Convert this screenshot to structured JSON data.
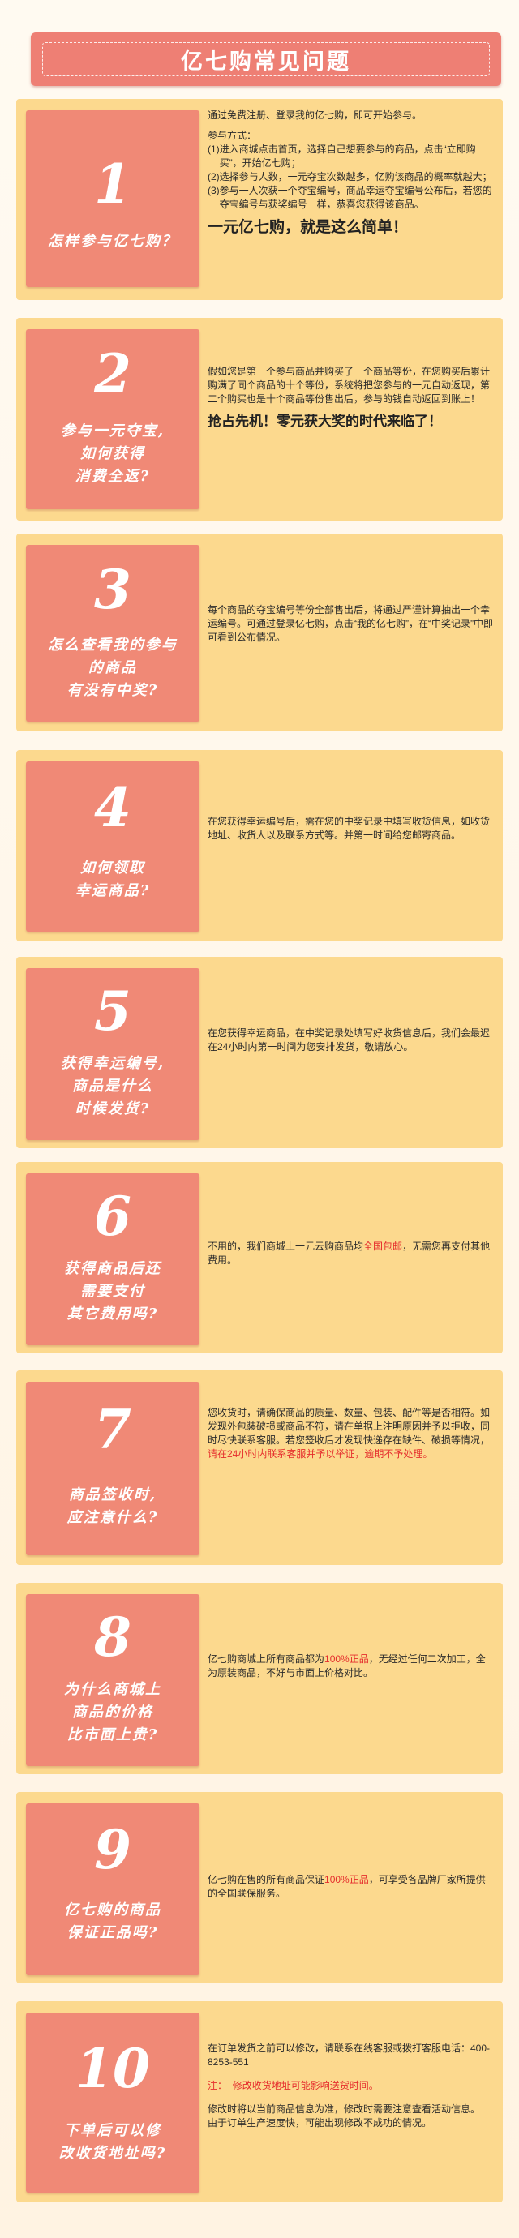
{
  "page_title": "亿七购常见问题",
  "faqs": [
    {
      "number": "1",
      "question": [
        "怎样参与亿七购？"
      ],
      "intro": "通过免费注册、登录我的亿七购，即可开始参与。",
      "methods_title": "参与方式：",
      "steps": [
        {
          "n": "(1)",
          "t": "进入商城点击首页，选择自己想要参与的商品，点击“立即购买”，开始亿七购；"
        },
        {
          "n": "(2)",
          "t": "选择参与人数，一元夺宝次数越多，亿购该商品的概率就越大；"
        },
        {
          "n": "(3)",
          "t": "参与一人次获一个夺宝编号，商品幸运夺宝编号公布后，若您的夺宝编号与获奖编号一样，恭喜您获得该商品。"
        }
      ],
      "highlight": "一元亿七购，就是这么简单！"
    },
    {
      "number": "2",
      "question": [
        "参与一元夺宝,",
        "如何获得",
        "消费全返?"
      ],
      "body": "假如您是第一个参与商品并购买了一个商品等份，在您购买后累计购满了同个商品的十个等份，系统将把您参与的一元自动返现，第二个购买也是十个商品等份售出后，参与的钱自动返回到账上！",
      "highlight": "抢占先机！零元获大奖的时代来临了！"
    },
    {
      "number": "3",
      "question": [
        "怎么查看我的参与",
        "的商品",
        "有没有中奖?"
      ],
      "body": "每个商品的夺宝编号等份全部售出后，将通过严谨计算抽出一个幸运编号。可通过登录亿七购，点击“我的亿七购”，在“中奖记录”中即可看到公布情况。"
    },
    {
      "number": "4",
      "question": [
        "如何领取",
        "幸运商品?"
      ],
      "body": "在您获得幸运编号后，需在您的中奖记录中填写收货信息，如收货地址、收货人以及联系方式等。并第一时间给您邮寄商品。"
    },
    {
      "number": "5",
      "question": [
        "获得幸运编号,",
        "商品是什么",
        "时候发货?"
      ],
      "body": "在您获得幸运商品，在中奖记录处填写好收货信息后，我们会最迟在24小时内第一时间为您安排发货，敬请放心。"
    },
    {
      "number": "6",
      "question": [
        "获得商品后还",
        "需要支付",
        "其它费用吗?"
      ],
      "body_pre": "不用的，我们商城上一元云购商品均",
      "body_red": "全国包邮",
      "body_post": "，无需您再支付其他费用。"
    },
    {
      "number": "7",
      "question": [
        "商品签收时,",
        "应注意什么?"
      ],
      "body": "您收货时，请确保商品的质量、数量、包装、配件等是否相符。如发现外包装破损或商品不符，请在单据上注明原因并予以拒收，同时尽快联系客服。若您签收后才发现快递存在缺件、破损等情况，",
      "body_red": "请在24小时内联系客服并予以举证，逾期不予处理。"
    },
    {
      "number": "8",
      "question": [
        "为什么商城上",
        "商品的价格",
        "比市面上贵?"
      ],
      "body_pre": "亿七购商城上所有商品都为",
      "body_red": "100%正品",
      "body_post": "，无经过任何二次加工，全为原装商品，不好与市面上价格对比。"
    },
    {
      "number": "9",
      "question": [
        "亿七购的商品",
        "保证正品吗?"
      ],
      "body_pre": "亿七购在售的所有商品保证",
      "body_red": "100%正品",
      "body_post": "，可享受各品牌厂家所提供的全国联保服务。"
    },
    {
      "number": "10",
      "question": [
        "下单后可以修",
        "改收货地址吗?"
      ],
      "body1": "在订单发货之前可以修改，请联系在线客服或拨打客服电话：400-8253-551",
      "note_label": "注：",
      "note_red": "修改收货地址可能影响送货时间。",
      "body2": "修改时将以当前商品信息为准，修改时需要注意查看活动信息。",
      "body3": "由于订单生产速度快，可能出现修改不成功的情况。"
    }
  ],
  "colors": {
    "header": "#ee7f74",
    "card": "#fcd98e",
    "badge": "#f08976",
    "emphasis": "#e52d2d"
  }
}
